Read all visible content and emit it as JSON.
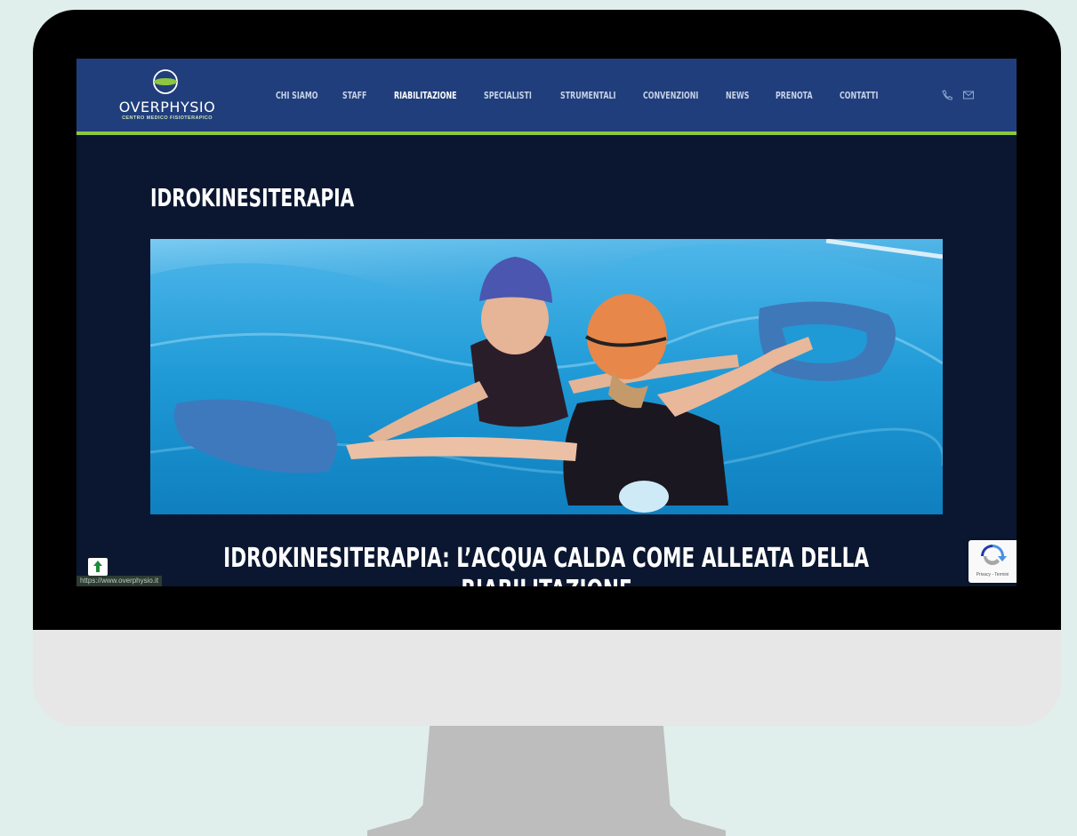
{
  "logo": {
    "name": "OVERPHYSIO",
    "tagline": "CENTRO MEDICO FISIOTERAPICO"
  },
  "nav": {
    "items": [
      {
        "label": "CHI SIAMO",
        "active": false
      },
      {
        "label": "STAFF",
        "active": false
      },
      {
        "label": "RIABILITAZIONE",
        "active": true
      },
      {
        "label": "SPECIALISTI",
        "active": false
      },
      {
        "label": "STRUMENTALI",
        "active": false
      },
      {
        "label": "CONVENZIONI",
        "active": false
      },
      {
        "label": "NEWS",
        "active": false
      },
      {
        "label": "PRENOTA",
        "active": false
      },
      {
        "label": "CONTATTI",
        "active": false
      }
    ],
    "icons": [
      "phone-icon",
      "mail-icon"
    ]
  },
  "page": {
    "title": "IDROKINESITERAPIA",
    "article_heading_line1": "IDROKINESITERAPIA: L’ACQUA CALDA COME ALLEATA DELLA",
    "article_heading_line2": "RIABILITAZIONE"
  },
  "status_bar": {
    "url": "https://www.overphysio.it"
  },
  "recaptcha": {
    "text": "Privacy - Termini"
  },
  "colors": {
    "header": "#203e7b",
    "accent": "#8dc63f",
    "page_background": "#0b1730",
    "water": "#1a9fd9"
  }
}
